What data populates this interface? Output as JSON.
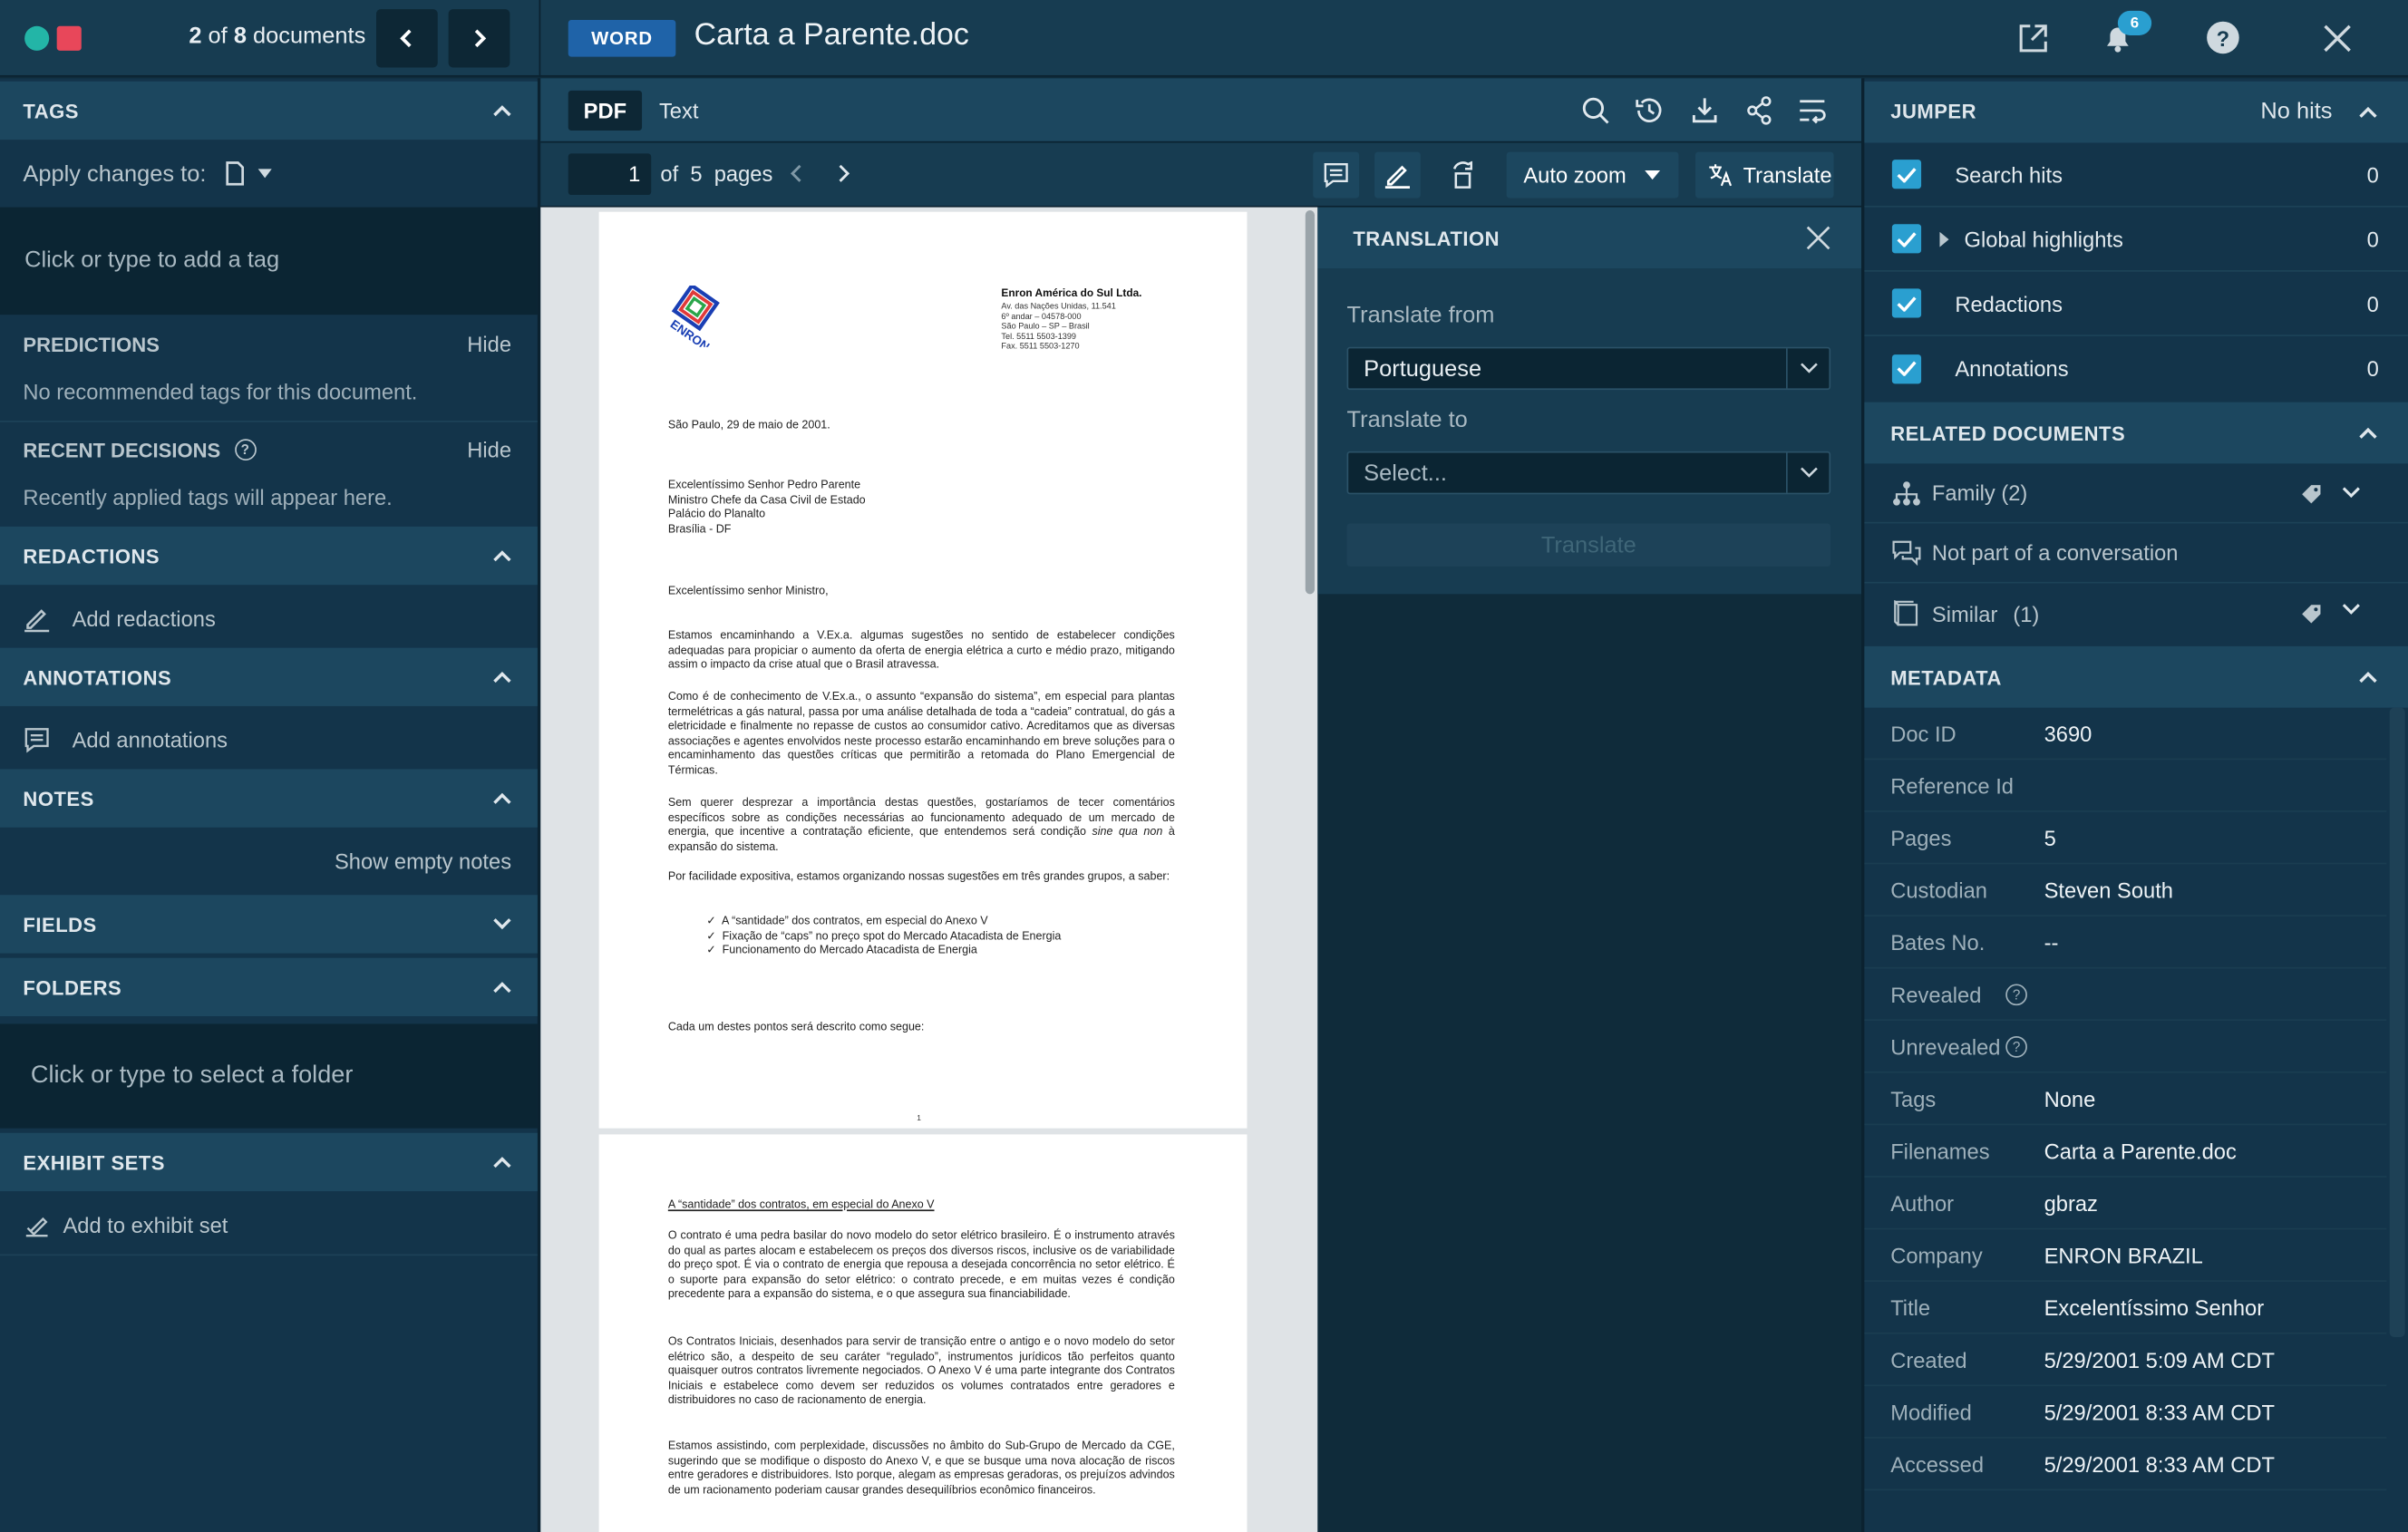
{
  "header": {
    "doc_counter": "2 of 8 documents",
    "doc_counter_current": "2",
    "doc_counter_total": "8",
    "file_type_badge": "WORD",
    "document_title": "Carta a Parente.doc",
    "notification_count": "6"
  },
  "left": {
    "tags": {
      "title": "TAGS",
      "apply_label": "Apply changes to:",
      "input_placeholder": "Click or type to add a tag"
    },
    "predictions": {
      "title": "PREDICTIONS",
      "hide": "Hide",
      "text": "No recommended tags for this document."
    },
    "recent": {
      "title": "RECENT DECISIONS",
      "hide": "Hide",
      "text": "Recently applied tags will appear here."
    },
    "redactions": {
      "title": "REDACTIONS",
      "action": "Add redactions"
    },
    "annotations": {
      "title": "ANNOTATIONS",
      "action": "Add annotations"
    },
    "notes": {
      "title": "NOTES",
      "action": "Show empty notes"
    },
    "fields": {
      "title": "FIELDS"
    },
    "folders": {
      "title": "FOLDERS",
      "input_placeholder": "Click or type to select a folder"
    },
    "exhibits": {
      "title": "EXHIBIT SETS",
      "action": "Add to exhibit set"
    }
  },
  "viewer": {
    "tabs": [
      "PDF",
      "Text"
    ],
    "page_current": "1",
    "page_of": "of",
    "page_total": "5",
    "pages_label": "pages",
    "zoom": "Auto zoom",
    "translate_button": "Translate"
  },
  "translation": {
    "title": "TRANSLATION",
    "from_label": "Translate from",
    "from_value": "Portuguese",
    "to_label": "Translate to",
    "to_placeholder": "Select...",
    "button": "Translate"
  },
  "jumper": {
    "title": "JUMPER",
    "status": "No hits",
    "items": [
      {
        "label": "Search hits",
        "count": "0"
      },
      {
        "label": "Global highlights",
        "count": "0"
      },
      {
        "label": "Redactions",
        "count": "0"
      },
      {
        "label": "Annotations",
        "count": "0"
      }
    ]
  },
  "related": {
    "title": "RELATED DOCUMENTS",
    "family": "Family (2)",
    "conversation": "Not part of a conversation",
    "similar": "Similar",
    "similar_count": "(1)"
  },
  "metadata": {
    "title": "METADATA",
    "rows": [
      {
        "key": "Doc ID",
        "value": "3690"
      },
      {
        "key": "Reference Id",
        "value": ""
      },
      {
        "key": "Pages",
        "value": "5"
      },
      {
        "key": "Custodian",
        "value": "Steven South"
      },
      {
        "key": "Bates No.",
        "value": "--"
      },
      {
        "key": "Revealed",
        "value": ""
      },
      {
        "key": "Unrevealed",
        "value": ""
      },
      {
        "key": "Tags",
        "value": "None"
      },
      {
        "key": "Filenames",
        "value": "Carta a Parente.doc"
      },
      {
        "key": "Author",
        "value": "gbraz"
      },
      {
        "key": "Company",
        "value": "ENRON BRAZIL"
      },
      {
        "key": "Title",
        "value": "Excelentíssimo Senhor"
      },
      {
        "key": "Created",
        "value": "5/29/2001 5:09 AM CDT"
      },
      {
        "key": "Modified",
        "value": "5/29/2001 8:33 AM CDT"
      },
      {
        "key": "Accessed",
        "value": "5/29/2001 8:33 AM CDT"
      }
    ]
  },
  "document": {
    "company": "Enron América do Sul Ltda.",
    "address": [
      "Av. das Nações Unidas, 11.541",
      "6º andar – 04578-000",
      "São Paulo – SP – Brasil",
      "Tel. 5511 5503-1399",
      "Fax. 5511 5503-1270"
    ],
    "logo_text": "ENRON",
    "date": "São Paulo, 29 de maio de 2001.",
    "recipient": [
      "Excelentíssimo Senhor Pedro Parente",
      "Ministro Chefe da Casa Civil de Estado",
      "Palácio do Planalto",
      "Brasília - DF"
    ],
    "salutation": "Excelentíssimo senhor Ministro,",
    "p1": "Estamos encaminhando a V.Ex.a. algumas sugestões no sentido de estabelecer condições adequadas para propiciar o aumento da oferta de energia elétrica a curto e médio prazo, mitigando assim o impacto da crise atual que o Brasil atravessa.",
    "p2": "Como é de conhecimento de V.Ex.a., o assunto “expansão do sistema”, em especial para plantas termelétricas a gás natural, passa por uma análise detalhada de toda a “cadeia” contratual, do gás a eletricidade e finalmente no repasse de custos ao consumidor cativo. Acreditamos que as diversas associações e agentes envolvidos neste processo estarão encaminhando em breve soluções para o encaminhamento das questões críticas que permitirão a retomada do Plano Emergencial de Térmicas.",
    "p3_a": "Sem querer desprezar a importância destas questões, gostaríamos de tecer comentários específicos sobre as condições necessárias ao funcionamento adequado de um mercado de energia, que incentive a contratação eficiente, que entendemos será condição ",
    "p3_em": "sine qua non",
    "p3_b": " à expansão do sistema.",
    "p4": "Por facilidade expositiva, estamos organizando nossas sugestões em três grandes grupos, a saber:",
    "bullets": [
      "A “santidade” dos contratos, em especial do Anexo V",
      "Fixação de “caps” no preço spot do Mercado Atacadista de Energia",
      "Funcionamento do Mercado Atacadista de Energia"
    ],
    "p5": "Cada um destes pontos será descrito como segue:",
    "page_number": "1",
    "page2_heading": "A “santidade” dos contratos, em especial do Anexo V",
    "page2_p1": "O contrato é uma pedra basilar do novo modelo do setor elétrico brasileiro. É o instrumento através do qual as partes alocam e estabelecem os preços dos diversos riscos, inclusive os de variabilidade do preço spot. É via o contrato de energia que repousa a desejada concorrência no setor elétrico. É o suporte para expansão do setor elétrico: o contrato precede, e em muitas vezes é condição precedente para a expansão do sistema, e o que assegura sua financiabilidade.",
    "page2_p2": "Os Contratos Iniciais, desenhados para servir de transição entre o antigo e o novo modelo do setor elétrico são, a despeito de seu caráter “regulado”, instrumentos jurídicos tão perfeitos quanto quaisquer outros contratos livremente negociados. O Anexo V é uma parte integrante dos Contratos Iniciais e estabelece como devem ser reduzidos os volumes contratados entre geradores e distribuidores no caso de racionamento de energia.",
    "page2_p3": "Estamos assistindo, com perplexidade, discussões no âmbito do Sub-Grupo de Mercado da CGE, sugerindo que se modifique o disposto do Anexo V, e que se busque uma nova alocação de riscos entre geradores e distribuidores. Isto porque, alegam as empresas geradoras, os prejuízos advindos de um racionamento poderiam causar grandes desequilíbrios econômico financeiros."
  },
  "colors": {
    "background": "#0f2b3a",
    "header": "#173c51",
    "section_header": "#1c475f",
    "accent": "#2a9fd0",
    "badge": "#1f63a8"
  }
}
